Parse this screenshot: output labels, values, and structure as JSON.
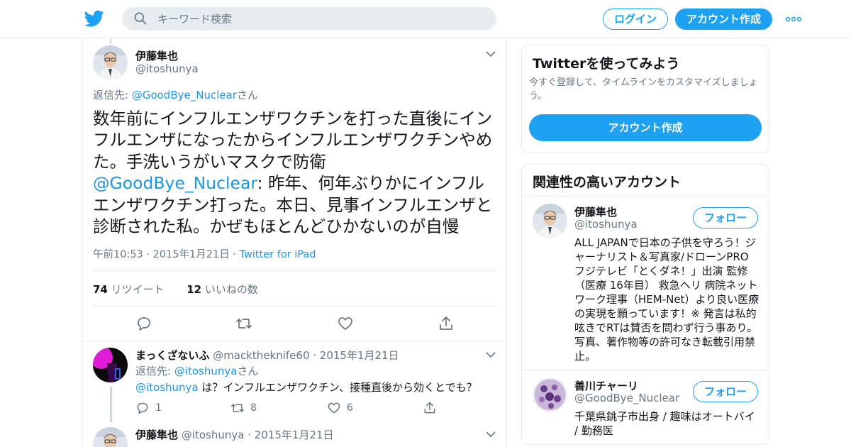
{
  "header": {
    "search_placeholder": "キーワード検索",
    "login_label": "ログイン",
    "signup_label": "アカウント作成"
  },
  "focus_tweet": {
    "name": "伊藤隼也",
    "handle": "@itoshunya",
    "reply_prefix": "返信先: ",
    "reply_to": "@GoodBye_Nuclear",
    "reply_suffix": "さん",
    "text_part1": "数年前にインフルエンザワクチンを打った直後にインフルエンザになったからインフルエンザワクチンやめた。手洗いうがいマスクで防衛",
    "text_mention": "@GoodBye_Nuclear",
    "text_part2": ": 昨年、何年ぶりかにインフルエンザワクチン打った。本日、見事インフルエンザと診断された私。かぜもほとんどひかないのが自慢",
    "timestamp": "午前10:53 · 2015年1月21日",
    "dot": " · ",
    "client": "Twitter for iPad",
    "retweets": "74",
    "retweets_label": " リツイート",
    "likes": "12",
    "likes_label": " いいねの数"
  },
  "replies": [
    {
      "name": "まっくざないふ",
      "handle": "@macktheknife60",
      "date": " · 2015年1月21日",
      "reply_prefix": "返信先: ",
      "reply_to": "@itoshunya",
      "reply_suffix": "さん",
      "mention": "@itoshunya",
      "text": " は？インフルエンザワクチン、接種直後から効くとでも？",
      "reply_count": "1",
      "retweet_count": "8",
      "like_count": "6"
    },
    {
      "name": "伊藤隼也",
      "handle": "@itoshunya",
      "date": " · 2015年1月21日"
    }
  ],
  "sidebar": {
    "try_title": "Twitterを使ってみよう",
    "try_desc": "今すぐ登録して、タイムラインをカスタマイズしましょう。",
    "try_button": "アカウント作成",
    "related_title": "関連性の高いアカウント",
    "accounts": [
      {
        "name": "伊藤隼也",
        "handle": "@itoshunya",
        "follow_label": "フォロー",
        "bio": "ALL JAPANで日本の子供を守ろう！ジャーナリスト＆写真家/ドローンPRO フジテレビ「とくダネ！」出演 監修（医療 16年目） 救急ヘリ 病院ネットワーク理事（HEM-Net）より良い医療の実現を願っています！※ 発言は私的呟きでRTは賛否を問わず行う事あり。写真、著作物等の許可なき転載引用禁止。"
      },
      {
        "name": "善川チャーリ",
        "handle": "@GoodBye_Nuclear",
        "follow_label": "フォロー",
        "bio": "千葉県銚子市出身 / 趣味はオートバイ / 勤務医"
      }
    ]
  },
  "colors": {
    "brand": "#1da1f2",
    "link": "#1b95e0",
    "muted": "#657786",
    "border": "#e6ecf0"
  },
  "icons": [
    "twitter-bird-icon",
    "search-icon",
    "more-dots-icon",
    "chevron-down-icon",
    "reply-icon",
    "retweet-icon",
    "like-icon",
    "share-icon"
  ]
}
